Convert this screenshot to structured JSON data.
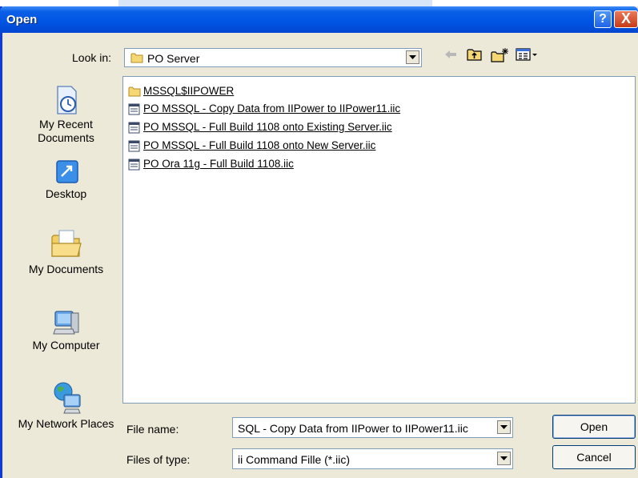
{
  "window": {
    "title": "Open",
    "help_glyph": "?",
    "close_glyph": "X"
  },
  "look_in": {
    "label": "Look in:",
    "value": "PO Server"
  },
  "toolbar": {
    "icons": [
      "back-arrow-icon",
      "up-folder-icon",
      "new-folder-icon",
      "view-menu-icon"
    ]
  },
  "places": [
    {
      "label": "My Recent Documents",
      "icon": "recent-documents-icon"
    },
    {
      "label": "Desktop",
      "icon": "desktop-icon"
    },
    {
      "label": "My Documents",
      "icon": "my-documents-icon"
    },
    {
      "label": "My Computer",
      "icon": "my-computer-icon"
    },
    {
      "label": "My Network Places",
      "icon": "network-places-icon"
    }
  ],
  "files": [
    {
      "name": "MSSQL$IIPOWER",
      "type": "folder"
    },
    {
      "name": "PO MSSQL - Copy Data from IIPower to IIPower11.iic",
      "type": "file"
    },
    {
      "name": "PO MSSQL - Full Build 1108 onto Existing Server.iic",
      "type": "file"
    },
    {
      "name": "PO MSSQL - Full Build 1108 onto New Server.iic",
      "type": "file"
    },
    {
      "name": "PO Ora 11g - Full Build 1108.iic",
      "type": "file"
    }
  ],
  "file_name": {
    "label": "File name:",
    "value": "SQL - Copy Data from IIPower to IIPower11.iic"
  },
  "file_type": {
    "label": "Files of type:",
    "value": "ii Command Fille (*.iic)"
  },
  "buttons": {
    "open": "Open",
    "cancel": "Cancel"
  },
  "colors": {
    "title_bar": "#0054e3",
    "dialog_bg": "#ece9d8",
    "close": "#c83a17"
  }
}
